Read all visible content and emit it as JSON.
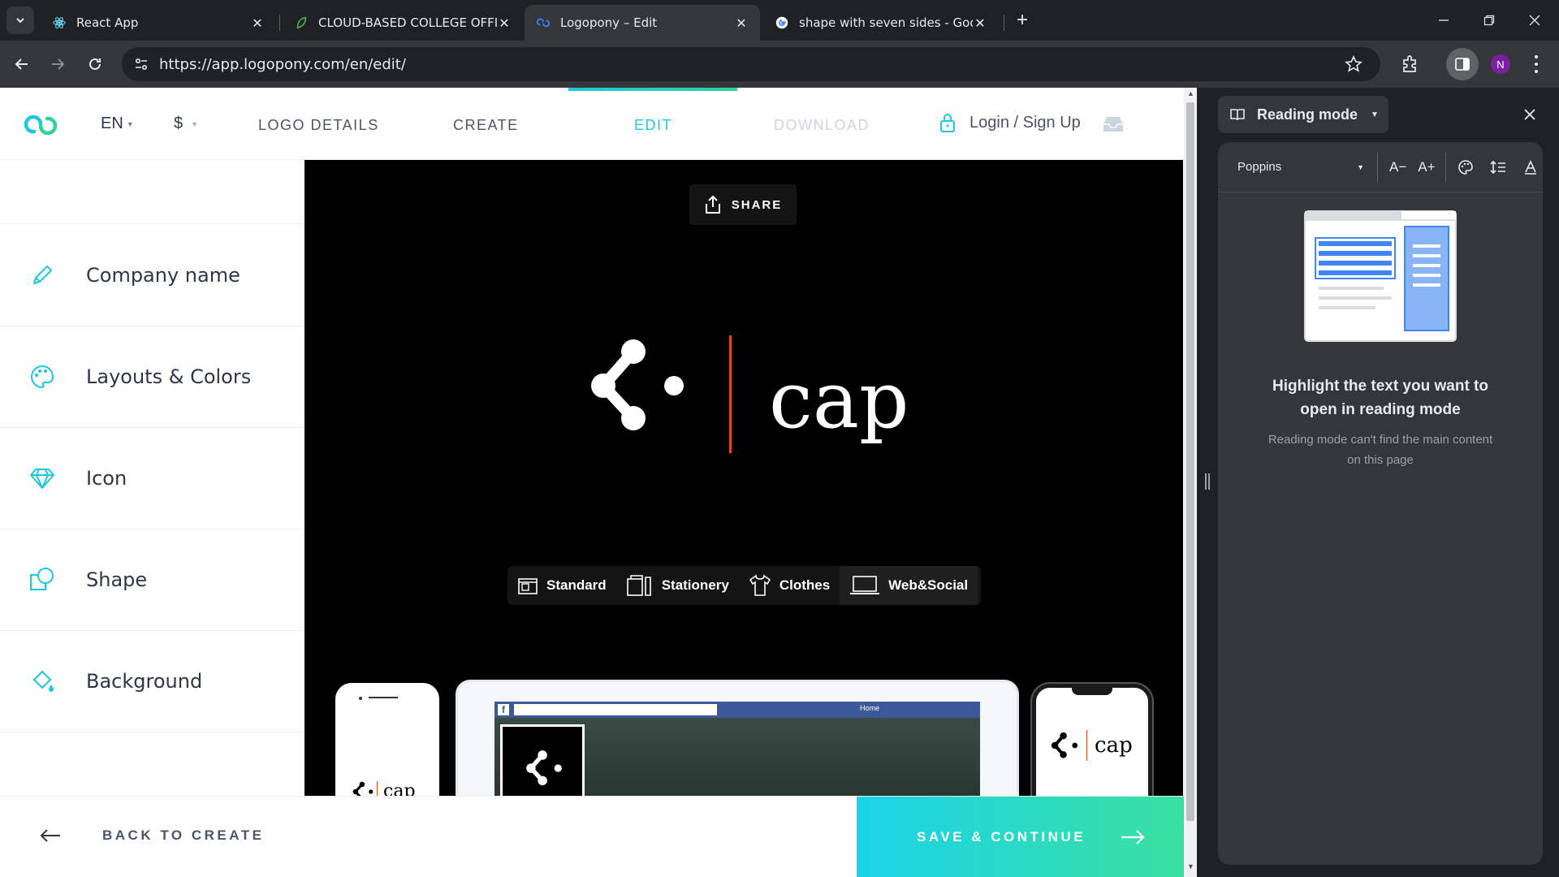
{
  "browser": {
    "tabs": [
      {
        "title": "React App",
        "icon": "react-icon",
        "active": false
      },
      {
        "title": "CLOUD-BASED COLLEGE OFFICE",
        "icon": "leaf-icon",
        "active": false
      },
      {
        "title": "Logopony – Edit",
        "icon": "logopony-icon",
        "active": true
      },
      {
        "title": "shape with seven sides - Google",
        "icon": "google-icon",
        "active": false
      }
    ],
    "new_tab": "+",
    "url": "https://app.logopony.com/en/edit/",
    "profile_initial": "N",
    "profile_color": "#7b1fa2"
  },
  "app": {
    "nav": {
      "lang": "EN",
      "currency": "$",
      "steps": [
        "LOGO DETAILS",
        "CREATE",
        "EDIT",
        "DOWNLOAD"
      ],
      "active_step": "EDIT",
      "login": "Login / Sign Up"
    },
    "sidebar": [
      {
        "label": "Company name",
        "icon": "pencil-icon"
      },
      {
        "label": "Layouts & Colors",
        "icon": "palette-icon"
      },
      {
        "label": "Icon",
        "icon": "diamond-icon"
      },
      {
        "label": "Shape",
        "icon": "shape-icon"
      },
      {
        "label": "Background",
        "icon": "paint-bucket-icon"
      }
    ],
    "share": "SHARE",
    "logo_text": "cap",
    "modes": [
      "Standard",
      "Stationery",
      "Clothes",
      "Web&Social"
    ],
    "selected_mode": "Web&Social",
    "mockups": {
      "phone_text": "cap",
      "fb_home": "Home",
      "iphone_text": "cap"
    },
    "back": "BACK TO CREATE",
    "save": "SAVE & CONTINUE",
    "accent": "#1ec8e0",
    "divider_color": "#e0491f"
  },
  "reading_mode": {
    "title": "Reading mode",
    "font": "Poppins",
    "size_down": "A−",
    "size_up": "A+",
    "heading": "Highlight the text you want to open in reading mode",
    "message": "Reading mode can't find the main content on this page"
  }
}
